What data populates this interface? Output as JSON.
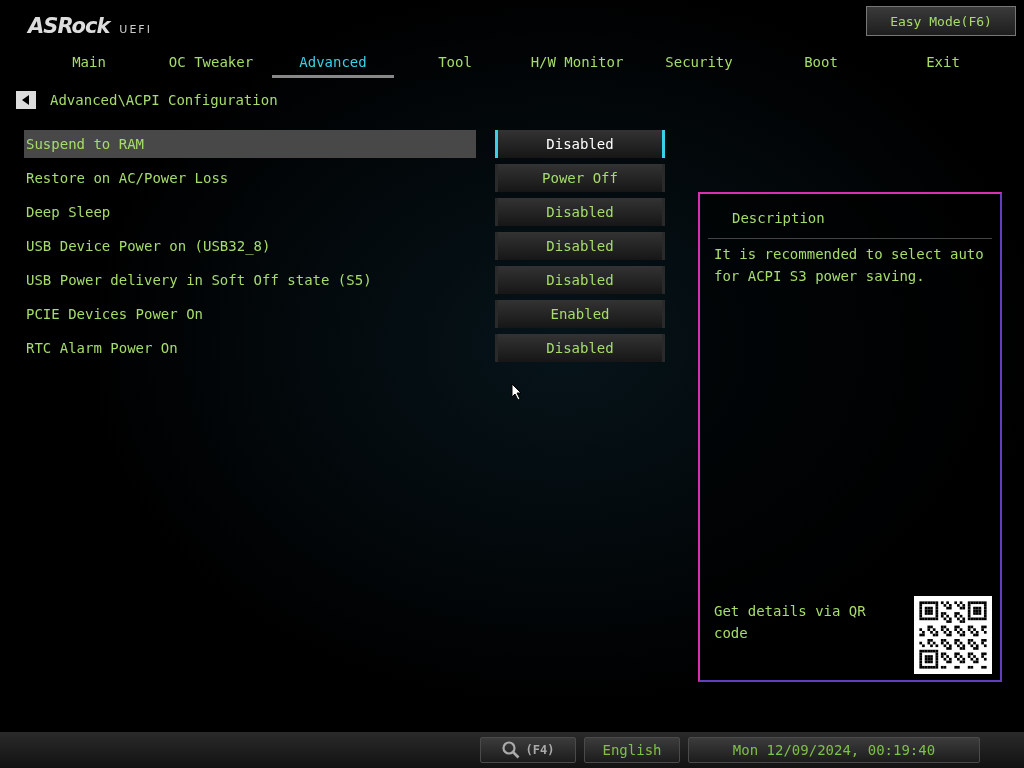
{
  "logo": {
    "brand": "ASRock",
    "suffix": "UEFI"
  },
  "easy_mode_button": "Easy Mode(F6)",
  "tabs": [
    {
      "label": "Main",
      "selected": false
    },
    {
      "label": "OC Tweaker",
      "selected": false
    },
    {
      "label": "Advanced",
      "selected": true
    },
    {
      "label": "Tool",
      "selected": false
    },
    {
      "label": "H/W Monitor",
      "selected": false
    },
    {
      "label": "Security",
      "selected": false
    },
    {
      "label": "Boot",
      "selected": false
    },
    {
      "label": "Exit",
      "selected": false
    }
  ],
  "breadcrumb": "Advanced\\ACPI Configuration",
  "settings": [
    {
      "label": "Suspend to RAM",
      "value": "Disabled",
      "selected": true
    },
    {
      "label": "Restore on AC/Power Loss",
      "value": "Power Off",
      "selected": false
    },
    {
      "label": "Deep Sleep",
      "value": "Disabled",
      "selected": false
    },
    {
      "label": "USB Device Power on (USB32_8)",
      "value": "Disabled",
      "selected": false
    },
    {
      "label": "USB Power delivery in Soft Off state (S5)",
      "value": "Disabled",
      "selected": false
    },
    {
      "label": "PCIE Devices Power On",
      "value": "Enabled",
      "selected": false
    },
    {
      "label": "RTC Alarm Power On",
      "value": "Disabled",
      "selected": false
    }
  ],
  "description": {
    "title": "Description",
    "text": "It is recommended to select auto for ACPI S3 power saving.",
    "qr_caption": "Get details via QR code"
  },
  "status_bar": {
    "search_key": "(F4)",
    "language": "English",
    "datetime": "Mon 12/09/2024, 00:19:40"
  }
}
